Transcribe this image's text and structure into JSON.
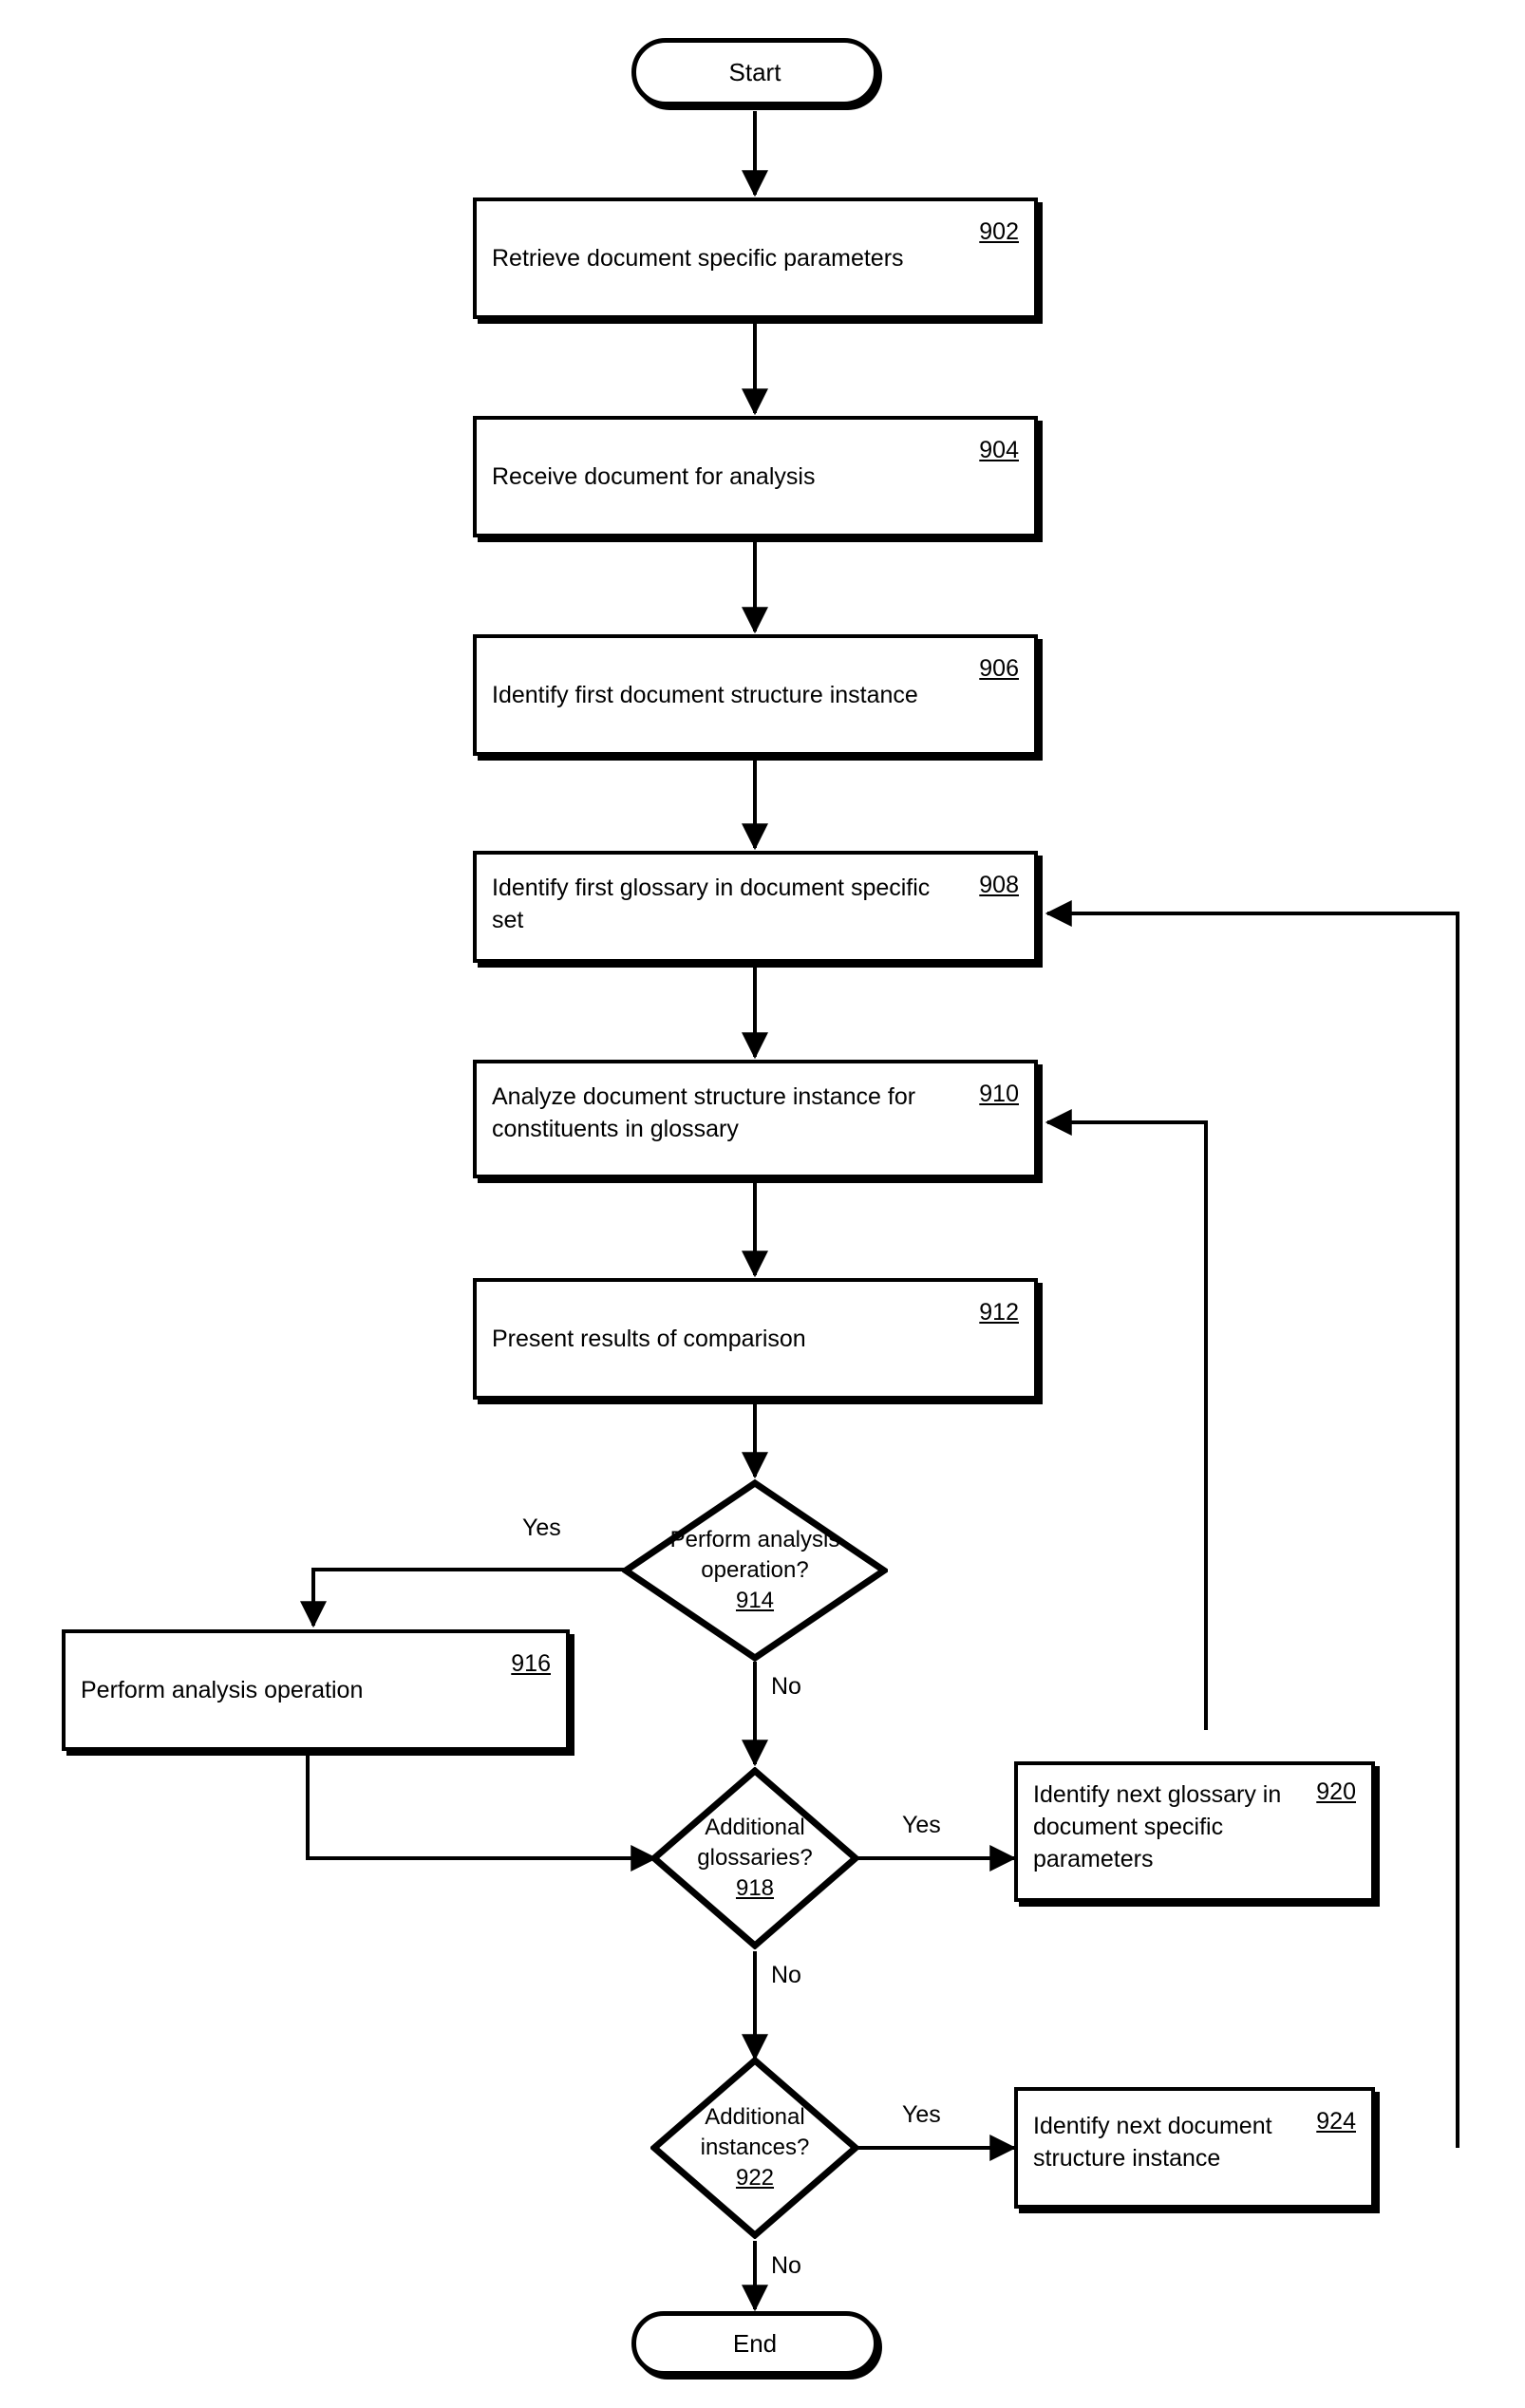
{
  "diagram": {
    "type": "flowchart",
    "nodes": {
      "start": {
        "label": "Start",
        "shape": "terminator"
      },
      "n902": {
        "label": "Retrieve document specific parameters",
        "number": "902",
        "shape": "process"
      },
      "n904": {
        "label": "Receive document for analysis",
        "number": "904",
        "shape": "process"
      },
      "n906": {
        "label": "Identify first document structure instance",
        "number": "906",
        "shape": "process"
      },
      "n908": {
        "label": "Identify first glossary in document specific set",
        "number": "908",
        "shape": "process"
      },
      "n910": {
        "label": "Analyze document structure instance for constituents in glossary",
        "number": "910",
        "shape": "process"
      },
      "n912": {
        "label": "Present results of comparison",
        "number": "912",
        "shape": "process"
      },
      "n914": {
        "line1": "Perform analysis",
        "line2": "operation?",
        "number": "914",
        "shape": "decision"
      },
      "n916": {
        "label": "Perform analysis operation",
        "number": "916",
        "shape": "process"
      },
      "n918": {
        "line1": "Additional",
        "line2": "glossaries?",
        "number": "918",
        "shape": "decision"
      },
      "n920": {
        "label": "Identify next glossary in document specific parameters",
        "number": "920",
        "shape": "process"
      },
      "n922": {
        "line1": "Additional",
        "line2": "instances?",
        "number": "922",
        "shape": "decision"
      },
      "n924": {
        "label": "Identify next document structure instance",
        "number": "924",
        "shape": "process"
      },
      "end": {
        "label": "End",
        "shape": "terminator"
      }
    },
    "edge_labels": {
      "e914_yes": "Yes",
      "e914_no": "No",
      "e918_yes": "Yes",
      "e918_no": "No",
      "e922_yes": "Yes",
      "e922_no": "No"
    },
    "colors": {
      "stroke": "#000000",
      "fill": "#ffffff"
    }
  }
}
